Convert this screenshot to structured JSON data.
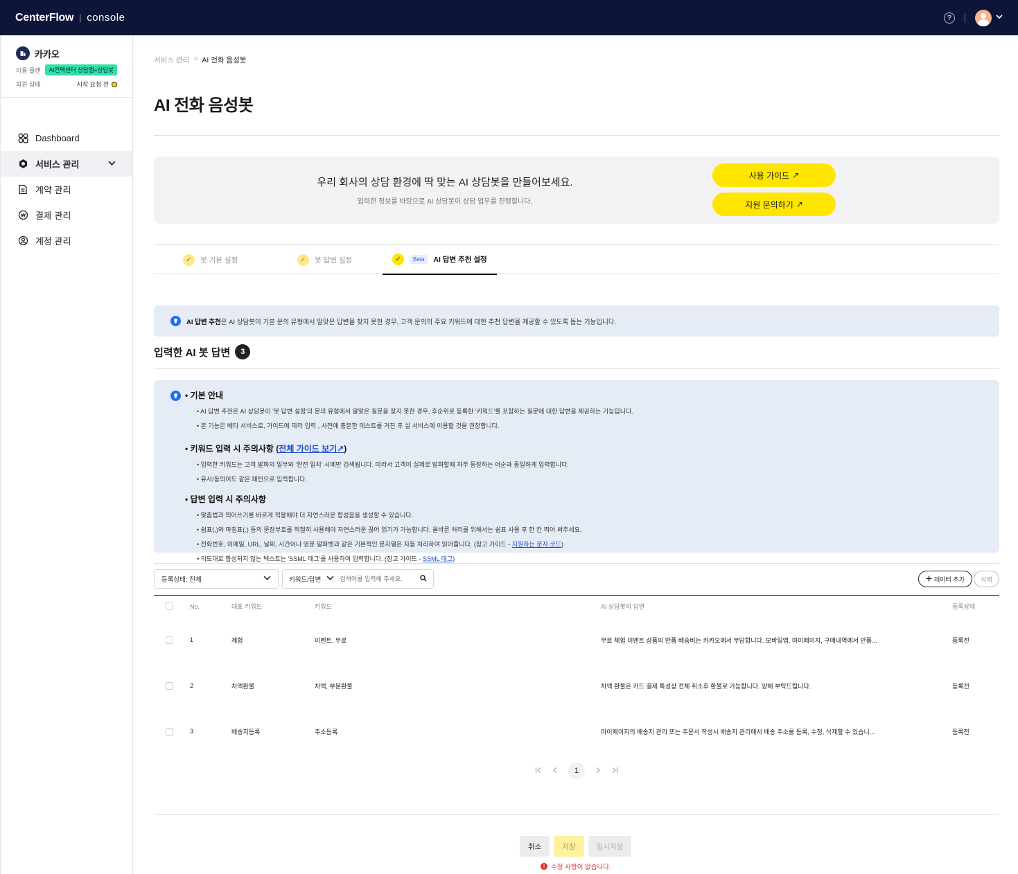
{
  "topbar": {
    "brand": "CenterFlow",
    "separator": "|",
    "product": "console",
    "help_icon": "question-circle-icon",
    "avatar_icon": "user-avatar-icon"
  },
  "sidebar": {
    "org_name": "카카오",
    "plan_label": "이용 플랜",
    "plan_value": "AI컨택센터 상담앱+상담봇",
    "status_label": "회원 상태",
    "status_value": "시작 요청 전",
    "items": [
      {
        "label": "Dashboard",
        "icon": "grid-icon"
      },
      {
        "label": "서비스 관리",
        "icon": "hexagon-icon"
      },
      {
        "label": "계약 관리",
        "icon": "document-icon"
      },
      {
        "label": "결제 관리",
        "icon": "coin-icon"
      },
      {
        "label": "계정 관리",
        "icon": "user-circle-icon"
      }
    ]
  },
  "breadcrumb": {
    "parent": "서비스 관리",
    "sep": ">",
    "current": "AI 전화 음성봇"
  },
  "page_title": "AI 전화 음성봇",
  "hero": {
    "title": "우리 회사의 상담 환경에 딱 맞는 AI 상담봇을 만들어보세요.",
    "subtitle": "입력한 정보를 바탕으로 AI 상담봇이 상담 업무를 진행합니다.",
    "guide_button": "사용 가이드",
    "support_button": "지원 문의하기",
    "arrow": "↗"
  },
  "tabs": [
    {
      "label": "봇 기본 설정"
    },
    {
      "label": "봇 답변 설정"
    },
    {
      "label": "AI 답변 추천 설정",
      "badge": "Beta"
    }
  ],
  "info_banner": {
    "bold": "AI 답변 추천",
    "text": "은 AI 상담봇이 기본 문의 유형에서 알맞은 답변을 찾지 못한 경우, 고객 문의의 주요 키워드에 대한 추천 답변을 제공할 수 있도록 돕는 기능입니다."
  },
  "section": {
    "title": "입력한 AI 봇 답변",
    "count": "3"
  },
  "guide": {
    "basic": {
      "heading": "• 기본 안내",
      "items": [
        "AI 답변 추천은 AI 상담봇이 '봇 답변 설정'의 문의 유형에서 알맞은 질문을 찾지 못한 경우, 후순위로 등록한 '키워드'를 포함하는 질문에 대한 답변을 제공하는 기능입니다.",
        "본 기능은 베타 서비스로, 가이드에 따라 입력 , 사전에 충분한 테스트를 거친 후 실 서비스에 이용할 것을 권장합니다."
      ]
    },
    "keyword": {
      "heading": "• 키워드 입력 시 주의사항 (",
      "link": "전체 가이드 보기↗",
      "heading_end": ")",
      "items": [
        "입력한 키워드는 고객 발화의 일부와 '완전 일치' 시에만 검색됩니다. 따라서 고객이 실제로 발화할때 자주 등장하는 어순과 동일하게 입력합니다.",
        "유사/동의어도 같은 패턴으로 입력합니다."
      ]
    },
    "answer": {
      "heading": "• 답변 입력 시 주의사항",
      "items": [
        "맞춤법과 띄어쓰기를 바르게 적용해야 더 자연스러운 합성음을 생성할 수 있습니다.",
        "쉼표(,)와 마침표(.) 등의 문장부호를 적절히 사용해야 자연스러운 끊어 읽기가 가능합니다. 올바른 처리를 위해서는 쉼표 사용 후 한 칸 띄어 써주세요."
      ],
      "item3_pre": "전화번호, 이메일, URL, 날짜, 시간이나 영문 알파벳과 같은 기본적인 문자열은 자동 처리하여 읽어줍니다. (참고 가이드 - ",
      "item3_link": "지원하는 문자 코드",
      "item3_post": ")",
      "item4_pre": "의도대로 합성되지 않는 텍스트는 'SSML 태그'를 사용하여 입력합니다. (참고 가이드 - ",
      "item4_link": "SSML 태그",
      "item4_post": ")"
    }
  },
  "filters": {
    "status_select": "등록상태: 전체",
    "search_type": "키워드/답변",
    "search_placeholder": "검색어를 입력해 주세요.",
    "add_button": "데이터 추가",
    "delete_button": "삭제"
  },
  "table": {
    "headers": [
      "No.",
      "대표 키워드",
      "키워드",
      "AI 상담봇의 답변",
      "등록상태"
    ],
    "rows": [
      {
        "no": "1",
        "main_keyword": "체험",
        "keywords": "이벤트, 무료",
        "answer": "무료 체험 이벤트 상품의 반품 배송비는 카카오에서 부담합니다. 모바일앱, 마이페이지, 구매내역에서 반품...",
        "status": "등록전"
      },
      {
        "no": "2",
        "main_keyword": "차액환불",
        "keywords": "차액, 부분환불",
        "answer": "차액 환불은 카드 결제 특성상 전체 취소후 환불로 가능합니다. 양해 부탁드립니다.",
        "status": "등록전"
      },
      {
        "no": "3",
        "main_keyword": "배송지등록",
        "keywords": "주소등록",
        "answer": "마이페이지의 배송지 관리 또는 주문서 작성시 배송지 관리에서 배송 주소를 등록, 수정, 삭제할 수 있습니...",
        "status": "등록전"
      }
    ]
  },
  "pagination": {
    "current": "1"
  },
  "footer": {
    "cancel": "취소",
    "save": "저장",
    "temp_save": "임시저장",
    "message": "수정 사항이 없습니다."
  },
  "colors": {
    "topbar": "#0d1538",
    "accent_yellow": "#ffe500",
    "plan_badge": "#2fe0a8",
    "info_bg": "#e6ecf6",
    "error": "#e03030"
  }
}
